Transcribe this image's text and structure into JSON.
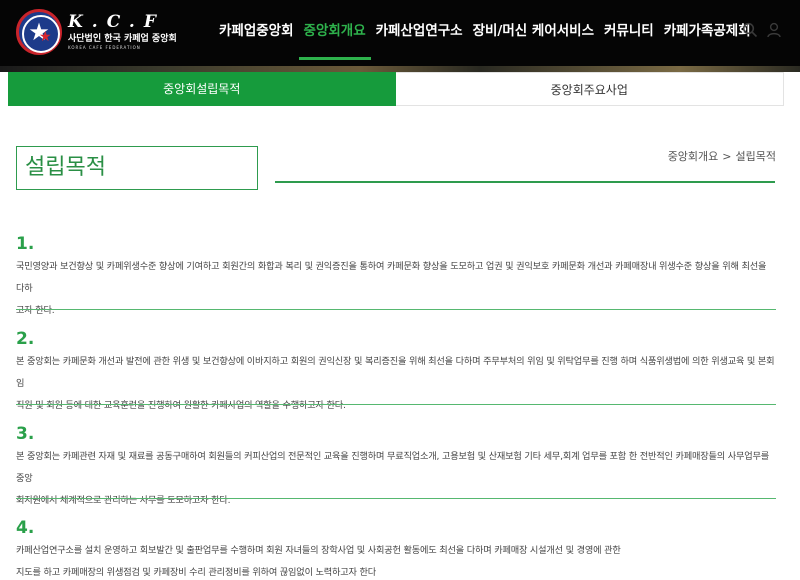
{
  "logo": {
    "name": "K.C.F",
    "korean": "사단법인 한국 카페업 중앙회",
    "english": "KOREA CAFE FEDERATION",
    "emblem_text": "KOREA CAFE"
  },
  "nav": {
    "items": [
      {
        "label": "카페업중앙회",
        "active": false
      },
      {
        "label": "중앙회개요",
        "active": true
      },
      {
        "label": "카페산업연구소",
        "active": false
      },
      {
        "label": "장비/머신 케어서비스",
        "active": false
      },
      {
        "label": "커뮤니티",
        "active": false
      },
      {
        "label": "카페가족공제회",
        "active": false
      }
    ],
    "icons": [
      "search-icon",
      "user-icon"
    ]
  },
  "tabs": [
    {
      "label": "중앙회설립목적",
      "active": true
    },
    {
      "label": "중앙회주요사업",
      "active": false
    }
  ],
  "page": {
    "title": "설립목적",
    "breadcrumb": {
      "parent": "중앙회개요",
      "separator": ">",
      "current": "설립목적"
    }
  },
  "sections": [
    {
      "number": "1.",
      "lines": [
        "국민영양과 보건향상 및 카페위생수준 향상에 기여하고 회원간의 화합과 복리 및 권익증진을 통하여 카페문화 향상을 도모하고 업권 및 권익보호 카페문화 개선과 카페매장내 위생수준 향상을 위해 최선을 다하",
        "고자 한다."
      ]
    },
    {
      "number": "2.",
      "lines": [
        "본 중앙회는 카페문화 개선과 발전에 관한 위생 및 보건향상에 이바지하고 회원의 권익신장 및 복리증진을 위해 최선을 다하며 주무부처의 위임 및 위탁업무를 진행 하며 식품위생법에 의한 위생교육 및 본회 임",
        "직원 및 회원 등에 대한 교육훈련을 진행하여 원활한 카페사업의 역할을 수행하고자 한다."
      ]
    },
    {
      "number": "3.",
      "lines": [
        "본 중앙회는 카페관련 자재 및 재료를 공동구매하여 회원들의 커피산업의 전문적인 교육을 진행하며 무료직업소개, 고용보험 및 산재보험 기타 세무,회계 업무를 포함 한 전반적인 카페매장들의 사무업무를 중앙",
        "회지원에서 체계적으로 관리하는 사무를 도모하고자 한다."
      ]
    },
    {
      "number": "4.",
      "lines": [
        "카페산업연구소를 설치 운영하고 회보발간 및 출판업무를 수행하며 회원 자녀들의 장학사업 및 사회공헌 활동에도 최선을 다하며 카페매장 시설개선 및 경영에 관한",
        "지도를 하고 카페매장의 위생점검 및 카페장비 수리 관리정비를 위하여 끊임없이 노력하고자 한다"
      ]
    }
  ],
  "colors": {
    "accent": "#169b3c",
    "header_bg": "#050505",
    "title_green": "#2a8f45"
  }
}
